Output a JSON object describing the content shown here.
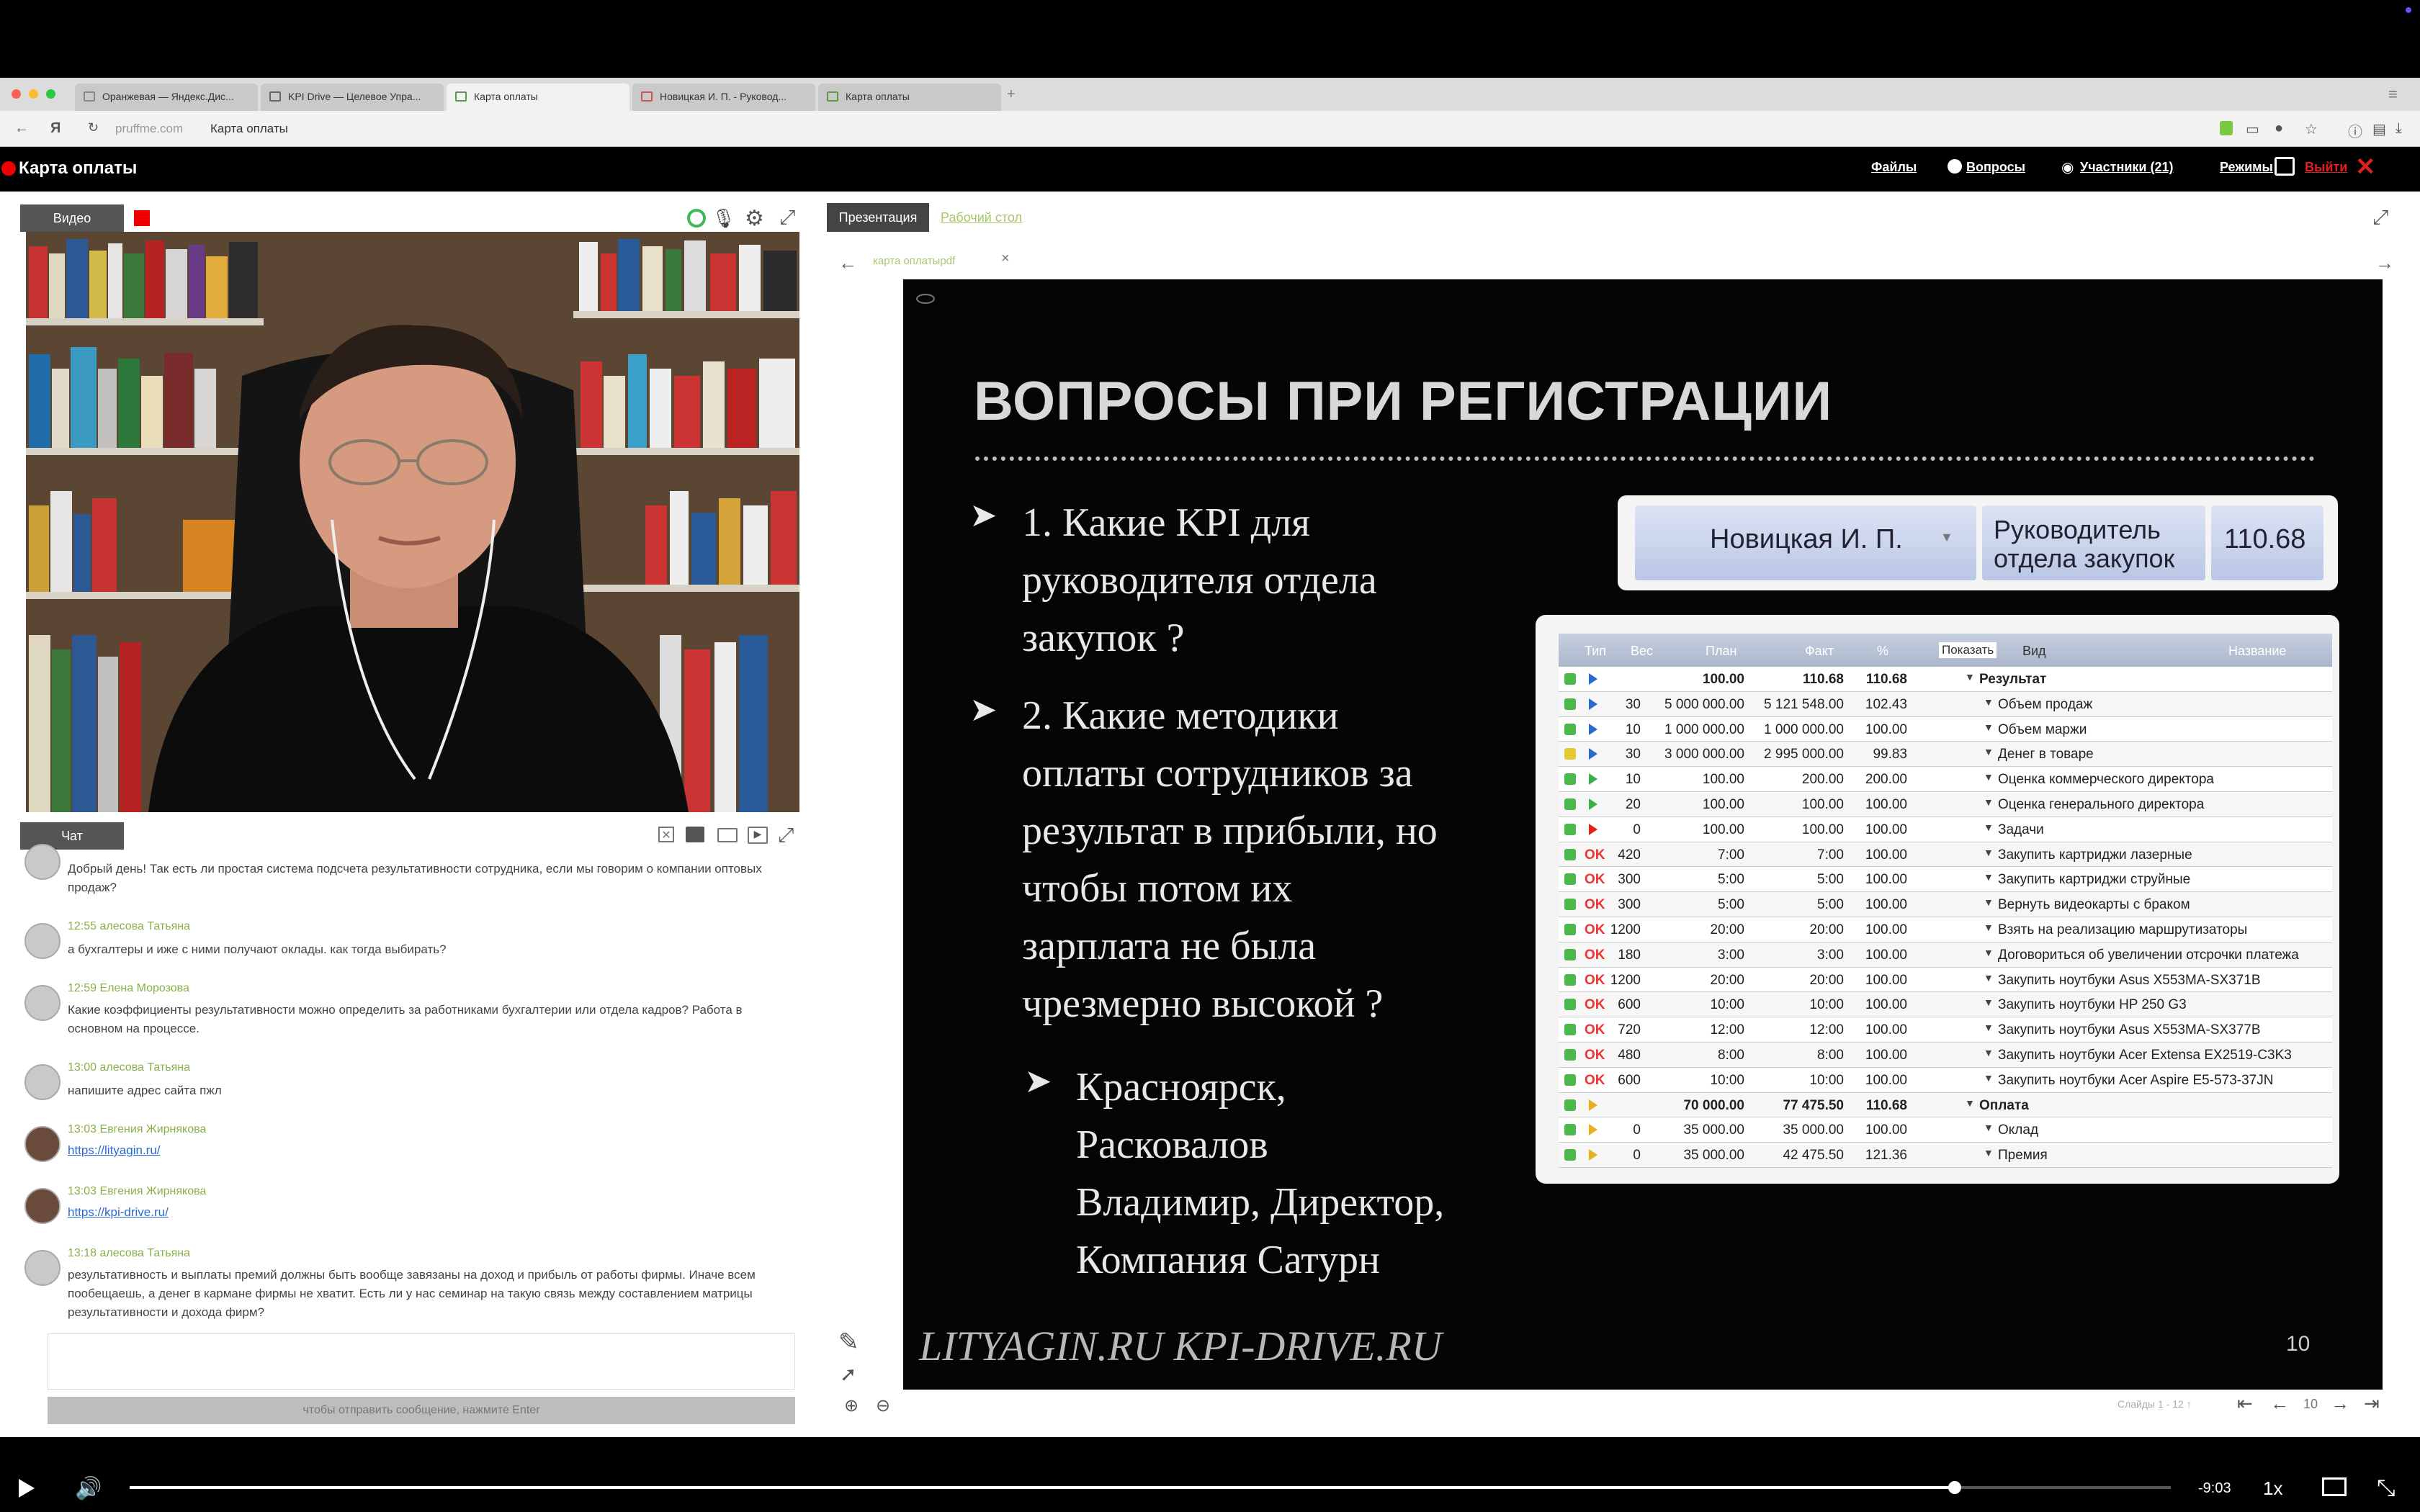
{
  "browser": {
    "tabs": [
      {
        "label": "Оранжевая — Яндекс.Дис..."
      },
      {
        "label": "KPI Drive — Целевое Упра..."
      },
      {
        "label": "Карта оплаты"
      },
      {
        "label": "Новицкая И. П. - Руковод..."
      },
      {
        "label": "Карта оплаты"
      }
    ],
    "address": {
      "domain": "pruffme.com",
      "title": "Карта оплаты"
    }
  },
  "app": {
    "title": "Карта оплаты",
    "nav": {
      "files": "Файлы",
      "questions": "Вопросы",
      "participants": "Участники (21)",
      "modes": "Режимы",
      "exit": "Выйти"
    }
  },
  "video_panel": {
    "tab": "Видео"
  },
  "chat": {
    "tab": "Чат",
    "messages": [
      {
        "meta": "",
        "text": "Добрый день! Так есть ли простая система подсчета результативности сотрудника, если мы говорим о компании оптовых продаж?"
      },
      {
        "meta": "12:55 алесова Татьяна",
        "text": "а бухгалтеры и иже с ними получают оклады. как тогда выбирать?"
      },
      {
        "meta": "12:59 Елена Морозова",
        "text": "Какие коэффициенты результативности можно определить за работниками бухгалтерии или отдела кадров? Работа в основном на процессе."
      },
      {
        "meta": "13:00 алесова Татьяна",
        "text": "напишите адрес сайта пжл"
      },
      {
        "meta": "13:03 Евгения Жирнякова",
        "text": "https://lityagin.ru/"
      },
      {
        "meta": "13:03 Евгения Жирнякова",
        "text": "https://kpi-drive.ru/"
      },
      {
        "meta": "13:18 алесова Татьяна",
        "text": "результативность и выплаты премий должны быть вообще завязаны на доход и прибыль от работы фирмы. Иначе всем пообещаешь, а денег в кармане фирмы не хватит. Есть ли у нас семинар на такую связь между составлением матрицы результативности и дохода фирм?"
      }
    ],
    "send_hint": "чтобы отправить сообщение, нажмите Enter"
  },
  "presentation": {
    "tab_active": "Презентация",
    "tab_other": "Рабочий стол",
    "file_name": "карта оплатыpdf",
    "slide": {
      "title": "ВОПРОСЫ ПРИ РЕГИСТРАЦИИ",
      "q1_lines": [
        "1. Какие KPI для",
        "руководителя отдела",
        "закупок ?"
      ],
      "q2_lines": [
        "2. Какие методики",
        "оплаты сотрудников за",
        "результат в прибыли, но",
        "чтобы потом их",
        "зарплата не была",
        "чрезмерно высокой ?"
      ],
      "q3_lines": [
        "Красноярск,",
        "Расковалов",
        "Владимир, Директор,",
        "Компания Сатурн"
      ],
      "footer": "LITYAGIN.RU  KPI-DRIVE.RU",
      "number": "10",
      "card": {
        "name": "Новицкая И. П.",
        "role_line1": "Руководитель",
        "role_line2": "отдела закупок",
        "score": "110.68"
      },
      "table": {
        "headers": [
          "Тип",
          "Вес",
          "План",
          "Факт",
          "%",
          "Показать",
          "Вид",
          "Название"
        ],
        "rows": [
          {
            "status": "green",
            "type": "blue",
            "w": "",
            "plan": "100.00",
            "fact": "110.68",
            "pct": "110.68",
            "name": "Результат",
            "bold": true
          },
          {
            "status": "green",
            "type": "blue",
            "w": "30",
            "plan": "5 000 000.00",
            "fact": "5 121 548.00",
            "pct": "102.43",
            "name": "Объем продаж",
            "bold": false
          },
          {
            "status": "green",
            "type": "blue",
            "w": "10",
            "plan": "1 000 000.00",
            "fact": "1 000 000.00",
            "pct": "100.00",
            "name": "Объем маржи",
            "bold": false
          },
          {
            "status": "yellow",
            "type": "blue",
            "w": "30",
            "plan": "3 000 000.00",
            "fact": "2 995 000.00",
            "pct": "99.83",
            "name": "Денег в товаре",
            "bold": false
          },
          {
            "status": "green",
            "type": "green",
            "w": "10",
            "plan": "100.00",
            "fact": "200.00",
            "pct": "200.00",
            "name": "Оценка коммерческого директора",
            "bold": false
          },
          {
            "status": "green",
            "type": "green",
            "w": "20",
            "plan": "100.00",
            "fact": "100.00",
            "pct": "100.00",
            "name": "Оценка генерального директора",
            "bold": false
          },
          {
            "status": "green",
            "type": "red",
            "w": "0",
            "plan": "100.00",
            "fact": "100.00",
            "pct": "100.00",
            "name": "Задачи",
            "bold": false
          },
          {
            "status": "green",
            "type": "OK",
            "w": "420",
            "plan": "7:00",
            "fact": "7:00",
            "pct": "100.00",
            "name": "Закупить картриджи лазерные",
            "bold": false
          },
          {
            "status": "green",
            "type": "OK",
            "w": "300",
            "plan": "5:00",
            "fact": "5:00",
            "pct": "100.00",
            "name": "Закупить картриджи струйные",
            "bold": false
          },
          {
            "status": "green",
            "type": "OK",
            "w": "300",
            "plan": "5:00",
            "fact": "5:00",
            "pct": "100.00",
            "name": "Вернуть видеокарты с браком",
            "bold": false
          },
          {
            "status": "green",
            "type": "OK",
            "w": "1200",
            "plan": "20:00",
            "fact": "20:00",
            "pct": "100.00",
            "name": "Взять на реализацию маршрутизаторы",
            "bold": false
          },
          {
            "status": "green",
            "type": "OK",
            "w": "180",
            "plan": "3:00",
            "fact": "3:00",
            "pct": "100.00",
            "name": "Договориться об увеличении отсрочки платежа",
            "bold": false
          },
          {
            "status": "green",
            "type": "OK",
            "w": "1200",
            "plan": "20:00",
            "fact": "20:00",
            "pct": "100.00",
            "name": "Закупить ноутбуки Asus X553MA-SX371B",
            "bold": false
          },
          {
            "status": "green",
            "type": "OK",
            "w": "600",
            "plan": "10:00",
            "fact": "10:00",
            "pct": "100.00",
            "name": "Закупить ноутбуки HP 250 G3",
            "bold": false
          },
          {
            "status": "green",
            "type": "OK",
            "w": "720",
            "plan": "12:00",
            "fact": "12:00",
            "pct": "100.00",
            "name": "Закупить ноутбуки Asus X553MA-SX377B",
            "bold": false
          },
          {
            "status": "green",
            "type": "OK",
            "w": "480",
            "plan": "8:00",
            "fact": "8:00",
            "pct": "100.00",
            "name": "Закупить ноутбуки Acer Extensa EX2519-C3K3",
            "bold": false
          },
          {
            "status": "green",
            "type": "OK",
            "w": "600",
            "plan": "10:00",
            "fact": "10:00",
            "pct": "100.00",
            "name": "Закупить ноутбуки Acer Aspire E5-573-37JN",
            "bold": false
          },
          {
            "status": "green",
            "type": "yellow",
            "w": "",
            "plan": "70 000.00",
            "fact": "77 475.50",
            "pct": "110.68",
            "name": "Оплата",
            "bold": true
          },
          {
            "status": "green",
            "type": "yellow",
            "w": "0",
            "plan": "35 000.00",
            "fact": "35 000.00",
            "pct": "100.00",
            "name": "Оклад",
            "bold": false
          },
          {
            "status": "green",
            "type": "yellow",
            "w": "0",
            "plan": "35 000.00",
            "fact": "42 475.50",
            "pct": "121.36",
            "name": "Премия",
            "bold": false
          }
        ]
      }
    },
    "pager": {
      "label": "Слайды 1 - 12 ↑",
      "page": "10"
    }
  },
  "player": {
    "time_remaining": "-9:03",
    "speed": "1x",
    "progress": 0.894
  }
}
